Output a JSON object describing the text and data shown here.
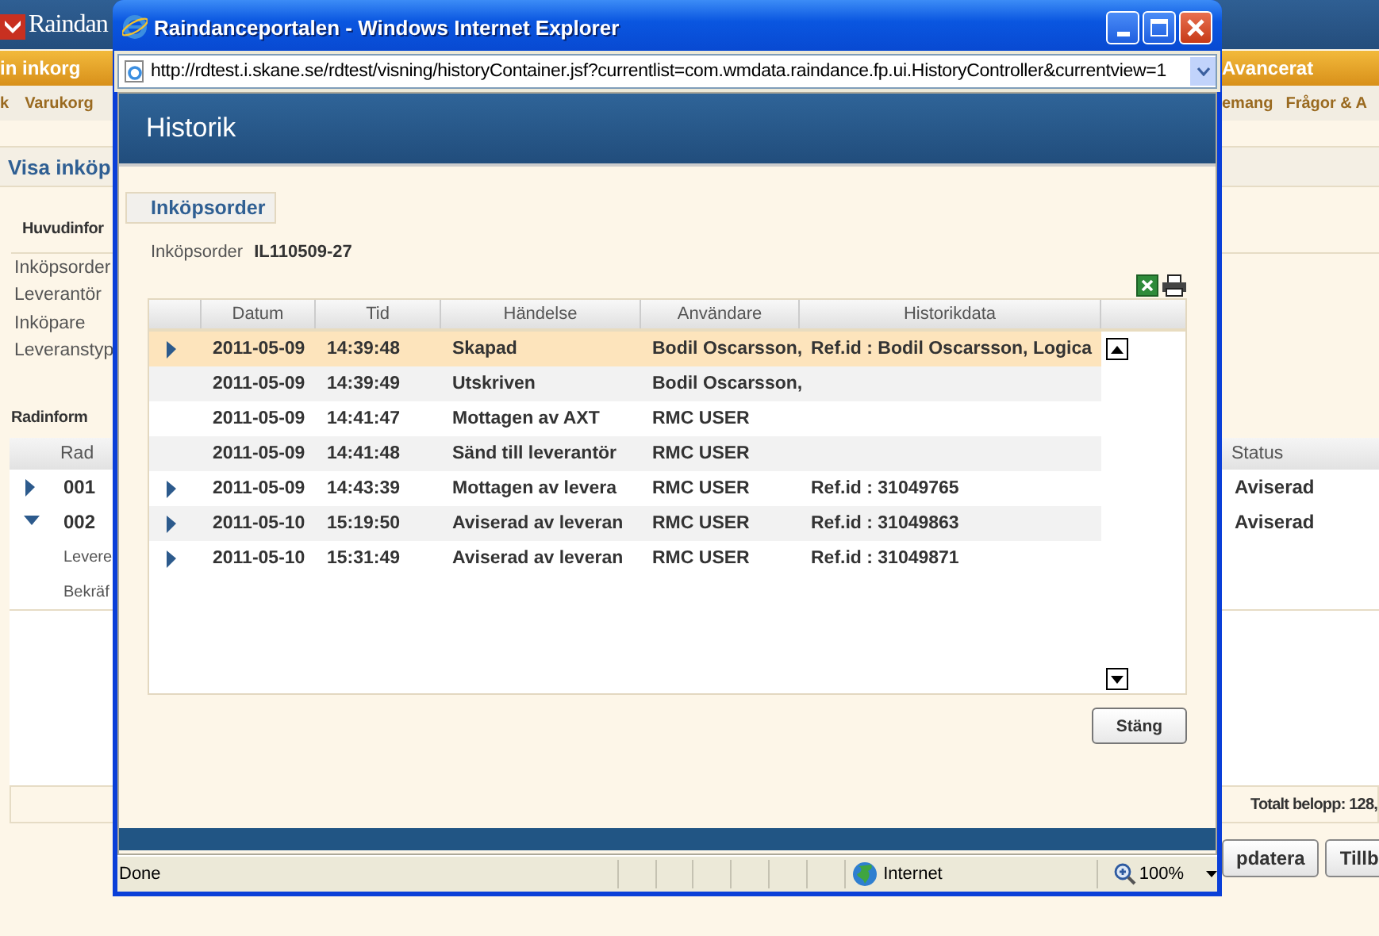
{
  "background_page": {
    "logo": "Raindan",
    "nav_left": "in inkorg",
    "nav_right": "Avancerat",
    "subnav_left": [
      "k",
      "Varukorg"
    ],
    "subnav_right": [
      "emang",
      "Frågor & A"
    ],
    "heading": "Visa inköp",
    "section_title": "Huvudinfor",
    "fields": [
      "Inköpsorder",
      "Leverantör",
      "Inköpare",
      "Leveranstyp"
    ],
    "rows_title": "Radinform",
    "table": {
      "left_column": "Rad",
      "right_column": "Status",
      "rows": [
        {
          "rad": "001",
          "expanded": false,
          "status": "Aviserad"
        },
        {
          "rad": "002",
          "expanded": true,
          "status": "Aviserad"
        }
      ],
      "sub_rows": [
        "Levere",
        "Bekräf"
      ]
    },
    "total": "Totalt belopp: 128,",
    "buttons": [
      "pdatera",
      "Tillb"
    ]
  },
  "popup": {
    "title": "Raindanceportalen - Windows Internet Explorer",
    "url": "http://rdtest.i.skane.se/rdtest/visning/historyContainer.jsf?currentlist=com.wmdata.raindance.fp.ui.HistoryController&currentview=1",
    "page_title": "Historik",
    "tab": "Inköpsorder",
    "order_label": "Inköpsorder",
    "order_number": "IL110509-27",
    "table": {
      "columns": [
        "Datum",
        "Tid",
        "Händelse",
        "Användare",
        "Historikdata"
      ],
      "rows": [
        {
          "datum": "2011-05-09",
          "tid": "14:39:48",
          "handelse": "Skapad",
          "anvandare": "Bodil Oscarsson,",
          "historikdata": "Ref.id : Bodil Oscarsson, Logica",
          "expandable": true,
          "selected": true
        },
        {
          "datum": "2011-05-09",
          "tid": "14:39:49",
          "handelse": "Utskriven",
          "anvandare": "Bodil Oscarsson,",
          "expandable": false,
          "selected": false
        },
        {
          "datum": "2011-05-09",
          "tid": "14:41:47",
          "handelse": "Mottagen av AXT",
          "anvandare": "RMC USER",
          "expandable": false,
          "selected": false
        },
        {
          "datum": "2011-05-09",
          "tid": "14:41:48",
          "handelse": "Sänd till leverantör",
          "anvandare": "RMC USER",
          "expandable": false,
          "selected": false
        },
        {
          "datum": "2011-05-09",
          "tid": "14:43:39",
          "handelse": "Mottagen av levera",
          "anvandare": "RMC USER",
          "historikdata": "Ref.id : 31049765",
          "expandable": true,
          "selected": false
        },
        {
          "datum": "2011-05-10",
          "tid": "15:19:50",
          "handelse": "Aviserad av leveran",
          "anvandare": "RMC USER",
          "historikdata": "Ref.id : 31049863",
          "expandable": true,
          "selected": false
        },
        {
          "datum": "2011-05-10",
          "tid": "15:31:49",
          "handelse": "Aviserad av leveran",
          "anvandare": "RMC USER",
          "historikdata": "Ref.id : 31049871",
          "expandable": true,
          "selected": false
        }
      ]
    },
    "close_button": "Stäng",
    "status_bar": {
      "text": "Done",
      "zone": "Internet",
      "zoom": "100%"
    }
  }
}
